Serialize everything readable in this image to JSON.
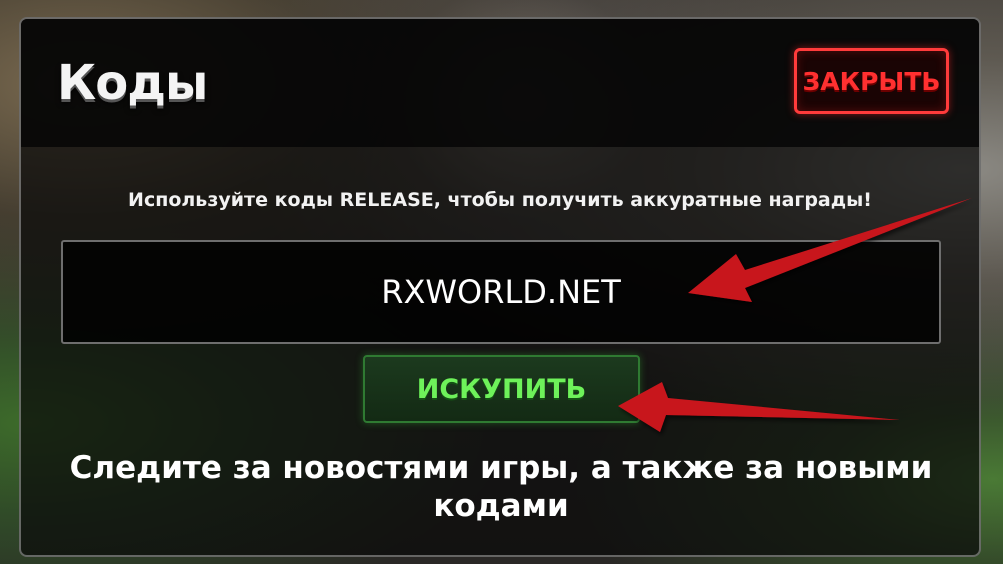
{
  "dialog": {
    "title": "Коды",
    "close_label": "ЗАКРЫТЬ",
    "hint": "Используйте коды RELEASE, чтобы получить аккуратные награды!",
    "code_value": "RXWORLD.NET",
    "redeem_label": "ИСКУПИТЬ",
    "news_line1": "Следите за новостями игры, а также за новыми",
    "news_line2": "кодами"
  },
  "colors": {
    "close_accent": "#ff3030",
    "redeem_accent": "#6ef25a",
    "arrow": "#c8141e"
  }
}
